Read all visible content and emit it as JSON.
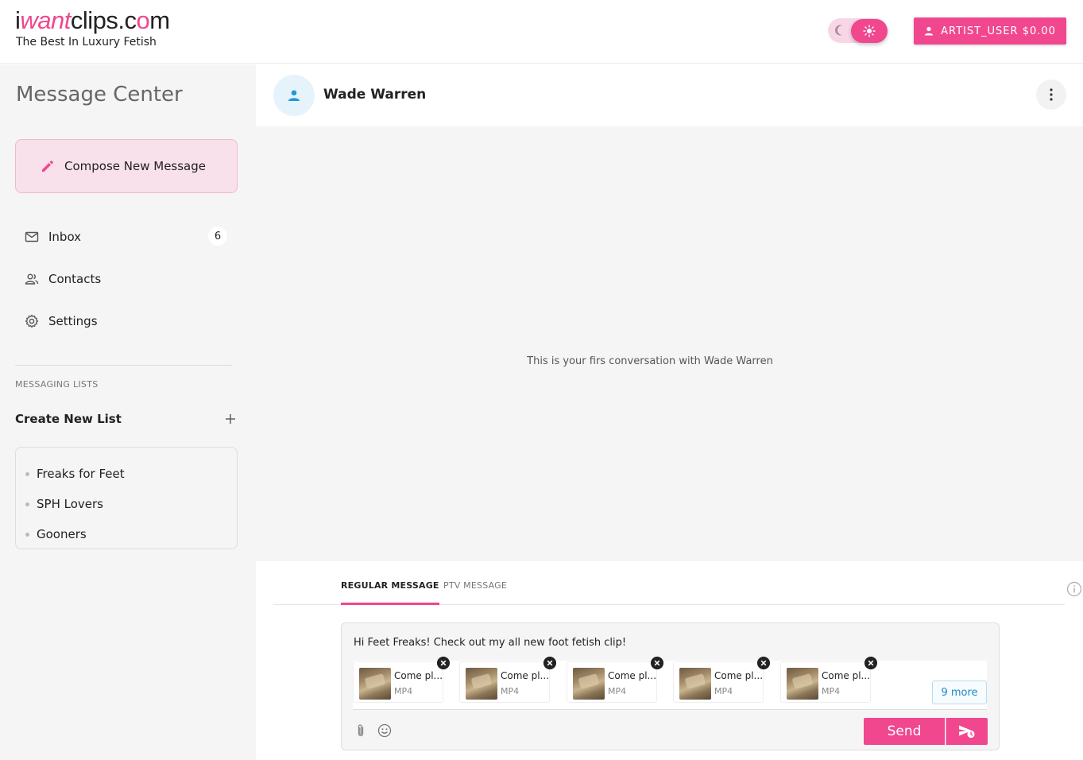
{
  "brand": {
    "logo_prefix": "i",
    "logo_want": "want",
    "logo_mid": "clips.c",
    "logo_o": "o",
    "logo_suffix": "m",
    "tagline": "The Best In Luxury Fetish"
  },
  "header": {
    "account_label": "ARTIST_USER $0.00",
    "theme_mode": "light"
  },
  "sidebar": {
    "title": "Message Center",
    "compose_label": "Compose New Message",
    "nav": [
      {
        "label": "Inbox",
        "icon": "mail-icon",
        "badge": "6"
      },
      {
        "label": "Contacts",
        "icon": "contacts-icon"
      },
      {
        "label": "Settings",
        "icon": "gear-icon"
      }
    ],
    "lists_section_label": "MESSAGING LISTS",
    "create_list_label": "Create New List",
    "lists": [
      "Freaks for Feet",
      "SPH Lovers",
      "Gooners"
    ]
  },
  "conversation": {
    "contact_name": "Wade Warren",
    "empty_text": "This is your firs conversation with Wade Warren"
  },
  "composer": {
    "tabs": [
      "REGULAR MESSAGE",
      "PTV MESSAGE"
    ],
    "active_tab": "REGULAR MESSAGE",
    "message_text": "Hi Feet Freaks! Check out my all new foot fetish clip!",
    "attachments": [
      {
        "title": "Come pl...",
        "type": "MP4"
      },
      {
        "title": "Come pl...",
        "type": "MP4"
      },
      {
        "title": "Come pl...",
        "type": "MP4"
      },
      {
        "title": "Come pl...",
        "type": "MP4"
      },
      {
        "title": "Come pl...",
        "type": "MP4"
      }
    ],
    "more_label": "9 more",
    "send_label": "Send"
  },
  "colors": {
    "accent": "#f0478f",
    "link": "#1e88c8"
  }
}
